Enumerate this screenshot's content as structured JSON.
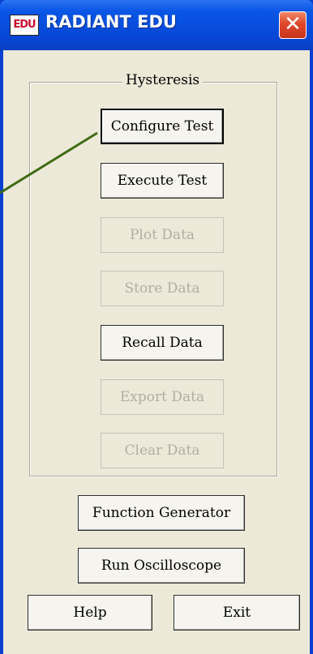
{
  "window": {
    "title": "RADIANT EDU",
    "icon_text": "EDU",
    "icon_name": "radiant-app-icon",
    "close_glyph": "✕"
  },
  "hysteresis": {
    "group_label": "Hysteresis",
    "buttons": [
      {
        "label": "Configure Test",
        "enabled": true
      },
      {
        "label": "Execute Test",
        "enabled": true
      },
      {
        "label": "Plot Data",
        "enabled": false
      },
      {
        "label": "Store Data",
        "enabled": false
      },
      {
        "label": "Recall Data",
        "enabled": true
      },
      {
        "label": "Export Data",
        "enabled": false
      },
      {
        "label": "Clear Data",
        "enabled": false
      }
    ]
  },
  "actions": {
    "function_generator": "Function Generator",
    "run_oscilloscope": "Run Oscilloscope",
    "help": "Help",
    "exit": "Exit"
  },
  "colors": {
    "titlebar": "#0a56e6",
    "client": "#ece9d8",
    "callout_line": "#3e6b12",
    "disabled_text": "#b0ada4"
  }
}
